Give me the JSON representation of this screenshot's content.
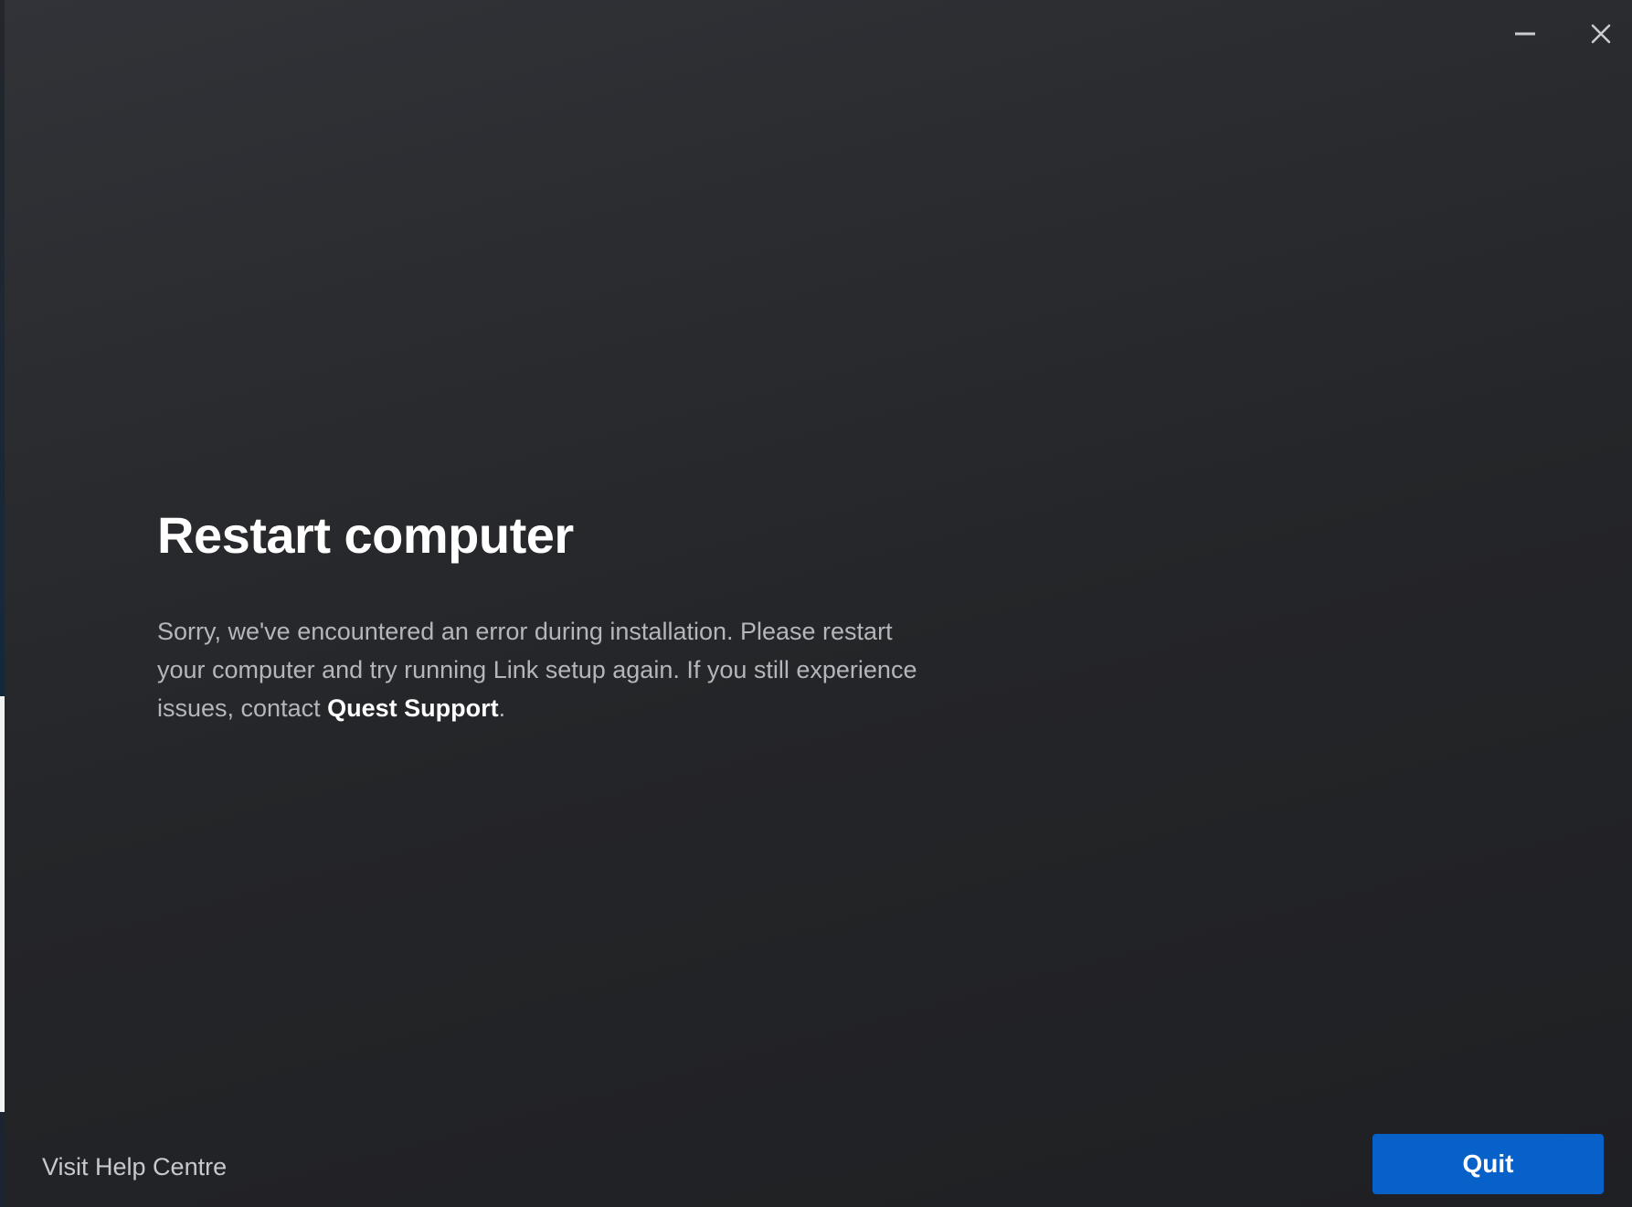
{
  "window": {
    "controls": {
      "minimize_icon": "minimize-icon",
      "close_icon": "close-icon"
    }
  },
  "dialog": {
    "title": "Restart computer",
    "message_main": "Sorry, we've encountered an error during installation. Please restart your computer and try running Link setup again. If you still experience issues, contact ",
    "support_link": "Quest Support",
    "message_end": "."
  },
  "footer": {
    "help_link": "Visit Help Centre",
    "quit_label": "Quit"
  },
  "colors": {
    "accent": "#0860c9",
    "background": "#242528",
    "title_text": "#ffffff",
    "body_text": "#b4b6bb"
  }
}
